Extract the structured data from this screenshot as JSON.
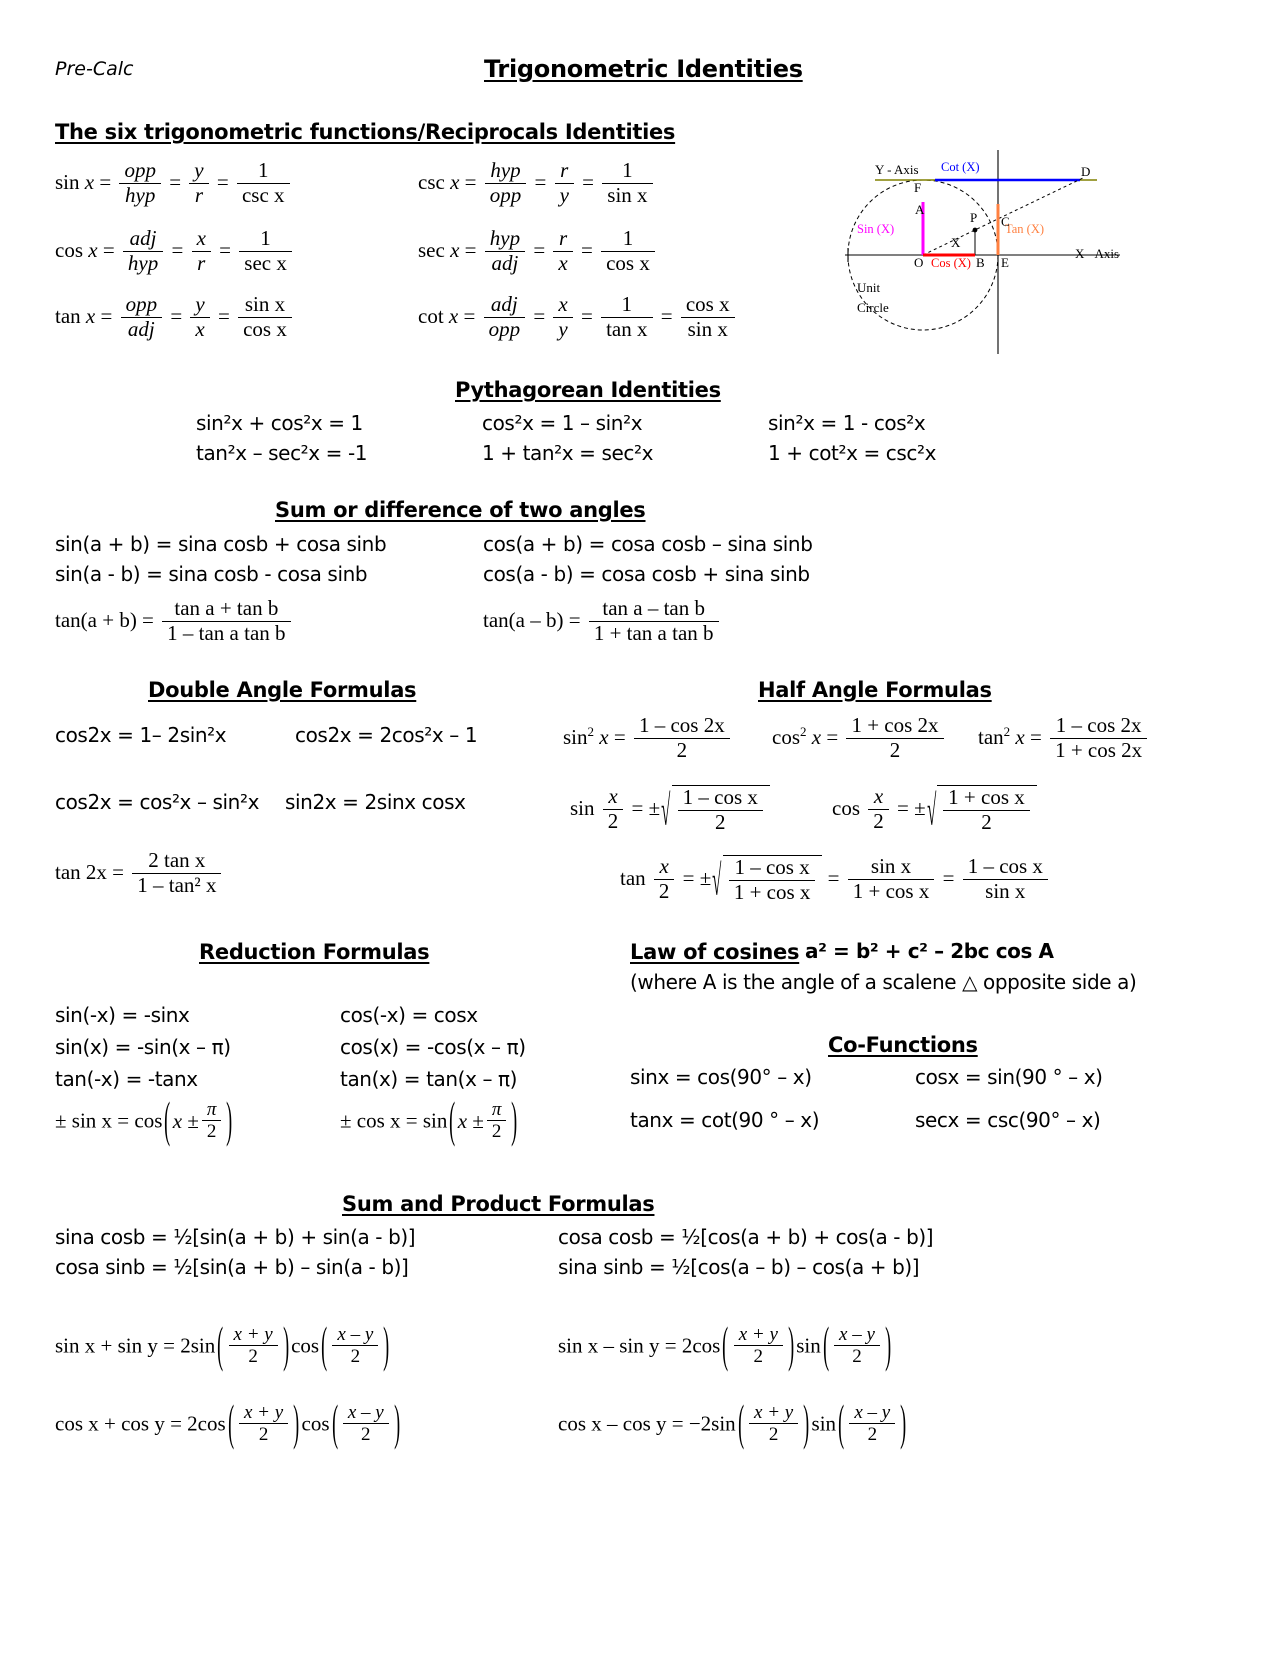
{
  "header": {
    "course": "Pre-Calc",
    "title": "Trigonometric Identities"
  },
  "sections": {
    "reciprocals": {
      "heading": "The six trigonometric functions/Reciprocals Identities",
      "left": [
        {
          "fn": "sin",
          "arg": "x",
          "ratio_num": "opp",
          "ratio_den": "hyp",
          "coord_num": "y",
          "coord_den": "r",
          "recip_num": "1",
          "recip_den": "csc x"
        },
        {
          "fn": "cos",
          "arg": "x",
          "ratio_num": "adj",
          "ratio_den": "hyp",
          "coord_num": "x",
          "coord_den": "r",
          "recip_num": "1",
          "recip_den": "sec x"
        },
        {
          "fn": "tan",
          "arg": "x",
          "ratio_num": "opp",
          "ratio_den": "adj",
          "coord_num": "y",
          "coord_den": "x",
          "recip_num": "sin x",
          "recip_den": "cos x"
        }
      ],
      "right": [
        {
          "fn": "csc",
          "arg": "x",
          "ratio_num": "hyp",
          "ratio_den": "opp",
          "coord_num": "r",
          "coord_den": "y",
          "recip_num": "1",
          "recip_den": "sin x"
        },
        {
          "fn": "sec",
          "arg": "x",
          "ratio_num": "hyp",
          "ratio_den": "adj",
          "coord_num": "r",
          "coord_den": "x",
          "recip_num": "1",
          "recip_den": "cos x"
        },
        {
          "fn": "cot",
          "arg": "x",
          "ratio_num": "adj",
          "ratio_den": "opp",
          "coord_num": "x",
          "coord_den": "y",
          "recip_num": "1",
          "recip_den": "tan x",
          "extra_num": "cos x",
          "extra_den": "sin x"
        }
      ]
    },
    "unit_circle": {
      "y_axis_label": "Y - Axis",
      "x_axis_label": "X - Axis",
      "caption_line1": "Unit",
      "caption_line2": "Circle",
      "angle_label": "X",
      "segments": [
        {
          "name": "Sin (X)",
          "color": "#ff00ff"
        },
        {
          "name": "Cos (X)",
          "color": "#ff0000"
        },
        {
          "name": "Tan (X)",
          "color": "#ff8040"
        },
        {
          "name": "Cot (X)",
          "color": "#0000ff"
        }
      ],
      "points": [
        "A",
        "F",
        "P",
        "C",
        "D",
        "O",
        "B",
        "E"
      ]
    },
    "pythagorean": {
      "heading": "Pythagorean Identities",
      "rows": [
        [
          "sin²x + cos²x = 1",
          "cos²x = 1 – sin²x",
          "sin²x = 1 - cos²x"
        ],
        [
          "tan²x – sec²x = -1",
          "1 + tan²x = sec²x",
          "1 + cot²x = csc²x"
        ]
      ]
    },
    "sum_difference": {
      "heading": "Sum or difference of two angles",
      "left": [
        "sin(a + b) = sina cosb + cosa sinb",
        "sin(a - b) = sina cosb - cosa sinb"
      ],
      "right": [
        "cos(a + b) = cosa cosb – sina sinb",
        "cos(a - b) = cosa cosb + sina sinb"
      ],
      "tan_sum": {
        "lhs": "tan(a + b) =",
        "num": "tan a + tan b",
        "den": "1 – tan a tan b"
      },
      "tan_diff": {
        "lhs": "tan(a – b) =",
        "num": "tan a – tan b",
        "den": "1 + tan a tan b"
      }
    },
    "double_angle": {
      "heading": "Double Angle Formulas",
      "rows": [
        [
          "cos2x = 1– 2sin²x",
          "cos2x = 2cos²x – 1"
        ],
        [
          "cos2x = cos²x – sin²x",
          "sin2x = 2sinx cosx"
        ]
      ],
      "tan2x": {
        "lhs": "tan 2x =",
        "num": "2 tan x",
        "den": "1 – tan² x"
      }
    },
    "half_angle": {
      "heading": "Half Angle Formulas",
      "squares": [
        {
          "lhs_fn": "sin",
          "lhs_pow": "2",
          "lhs_arg": "x",
          "num": "1 – cos 2x",
          "den": "2"
        },
        {
          "lhs_fn": "cos",
          "lhs_pow": "2",
          "lhs_arg": "x",
          "num": "1 + cos 2x",
          "den": "2"
        },
        {
          "lhs_fn": "tan",
          "lhs_pow": "2",
          "lhs_arg": "x",
          "num": "1 – cos 2x",
          "den": "1 + cos 2x"
        }
      ],
      "roots": [
        {
          "fn": "sin",
          "arg_num": "x",
          "arg_den": "2",
          "sign": "±",
          "rad_num": "1 – cos x",
          "rad_den": "2"
        },
        {
          "fn": "cos",
          "arg_num": "x",
          "arg_den": "2",
          "sign": "±",
          "rad_num": "1 + cos x",
          "rad_den": "2"
        }
      ],
      "tan_half": {
        "fn": "tan",
        "arg_num": "x",
        "arg_den": "2",
        "sign": "±",
        "rad_num": "1 – cos x",
        "rad_den": "1 + cos x",
        "eq2_num": "sin x",
        "eq2_den": "1 + cos x",
        "eq3_num": "1 – cos x",
        "eq3_den": "sin x"
      }
    },
    "reduction": {
      "heading": "Reduction Formulas",
      "left": [
        "sin(-x) = -sinx",
        "sin(x) = -sin(x – π)",
        "tan(-x) = -tanx"
      ],
      "right": [
        "cos(-x) = cosx",
        "cos(x) = -cos(x – π)",
        "tan(x) = tan(x – π)"
      ],
      "pm_sin": {
        "lhs": "± sin x = cos",
        "inner_lead": "x ±",
        "inner_num": "π",
        "inner_den": "2"
      },
      "pm_cos": {
        "lhs": "± cos x = sin",
        "inner_lead": "x ±",
        "inner_num": "π",
        "inner_den": "2"
      }
    },
    "law_of_cosines": {
      "heading": "Law of cosines",
      "formula": "a² = b² + c² – 2bc cos A",
      "note": "(where A is the angle of a scalene △ opposite side a)"
    },
    "co_functions": {
      "heading": "Co-Functions",
      "rows": [
        [
          "sinx = cos(90° – x)",
          "cosx = sin(90 ° – x)"
        ],
        [
          "tanx = cot(90 ° – x)",
          "secx = csc(90° – x)"
        ]
      ]
    },
    "sum_product": {
      "heading": "Sum and Product Formulas",
      "product_rows": [
        [
          "sina cosb = ½[sin(a + b) + sin(a - b)]",
          "cosa cosb = ½[cos(a + b) + cos(a - b)]"
        ],
        [
          "cosa sinb = ½[sin(a + b) – sin(a - b)]",
          "sina sinb = ½[cos(a – b) – cos(a + b)]"
        ]
      ],
      "sum_formulas": [
        {
          "lhs": "sin x + sin y = 2sin",
          "f1_num": "x + y",
          "f1_den": "2",
          "mid": "cos",
          "f2_num": "x – y",
          "f2_den": "2"
        },
        {
          "lhs": "sin x – sin y = 2cos",
          "f1_num": "x + y",
          "f1_den": "2",
          "mid": "sin",
          "f2_num": "x – y",
          "f2_den": "2"
        },
        {
          "lhs": "cos x + cos y = 2cos",
          "f1_num": "x + y",
          "f1_den": "2",
          "mid": "cos",
          "f2_num": "x – y",
          "f2_den": "2"
        },
        {
          "lhs": "cos x – cos y = −2sin",
          "f1_num": "x + y",
          "f1_den": "2",
          "mid": "sin",
          "f2_num": "x – y",
          "f2_den": "2"
        }
      ]
    }
  }
}
